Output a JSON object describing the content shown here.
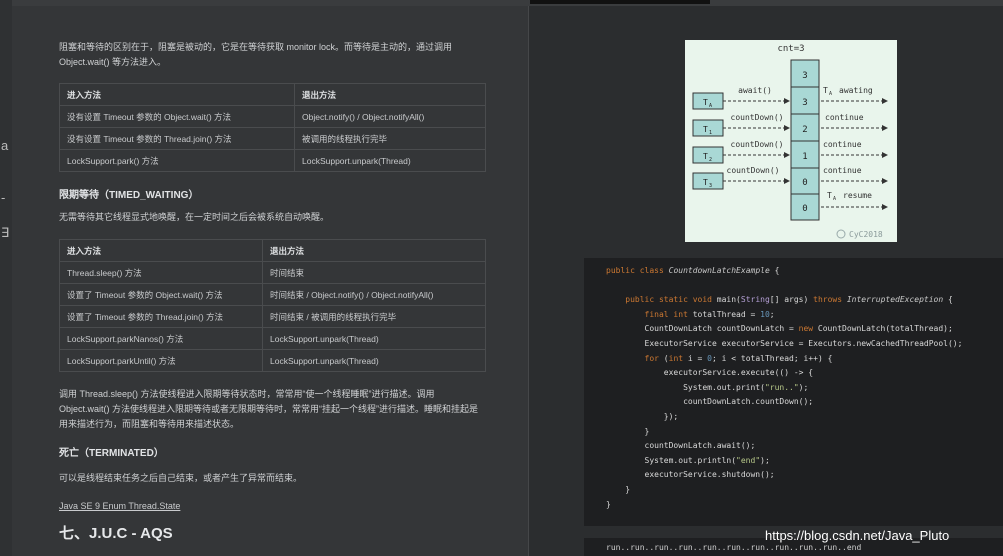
{
  "doc": {
    "intro": "阻塞和等待的区别在于，阻塞是被动的，它是在等待获取 monitor lock。而等待是主动的，通过调用 Object.wait() 等方法进入。",
    "table1": {
      "headers": [
        "进入方法",
        "退出方法"
      ],
      "rows": [
        [
          "没有设置 Timeout 参数的 Object.wait() 方法",
          "Object.notify() / Object.notifyAll()"
        ],
        [
          "没有设置 Timeout 参数的 Thread.join() 方法",
          "被调用的线程执行完毕"
        ],
        [
          "LockSupport.park() 方法",
          "LockSupport.unpark(Thread)"
        ]
      ]
    },
    "timed_heading": "限期等待（TIMED_WAITING）",
    "timed_desc": "无需等待其它线程显式地唤醒，在一定时间之后会被系统自动唤醒。",
    "table2": {
      "headers": [
        "进入方法",
        "退出方法"
      ],
      "rows": [
        [
          "Thread.sleep() 方法",
          "时间结束"
        ],
        [
          "设置了 Timeout 参数的 Object.wait() 方法",
          "时间结束 / Object.notify() / Object.notifyAll()"
        ],
        [
          "设置了 Timeout 参数的 Thread.join() 方法",
          "时间结束 / 被调用的线程执行完毕"
        ],
        [
          "LockSupport.parkNanos() 方法",
          "LockSupport.unpark(Thread)"
        ],
        [
          "LockSupport.parkUntil() 方法",
          "LockSupport.unpark(Thread)"
        ]
      ]
    },
    "sleep_para": "调用 Thread.sleep() 方法使线程进入限期等待状态时，常常用“使一个线程睡眠”进行描述。调用 Object.wait() 方法使线程进入限期等待或者无限期等待时，常常用“挂起一个线程”进行描述。睡眠和挂起是用来描述行为，而阻塞和等待用来描述状态。",
    "terminated_heading": "死亡（TERMINATED）",
    "terminated_desc": "可以是线程结束任务之后自己结束，或者产生了异常而结束。",
    "link": "Java SE 9 Enum Thread.State",
    "section_heading": "七、J.U.C - AQS"
  },
  "diagram": {
    "title": "cnt=3",
    "threads": [
      "T",
      "T",
      "T",
      "T"
    ],
    "thread_subs": [
      "A",
      "1",
      "2",
      "3"
    ],
    "calls": [
      "await()",
      "countDown()",
      "countDown()",
      "countDown()"
    ],
    "counts": [
      "3",
      "3",
      "2",
      "1",
      "0",
      "0"
    ],
    "results": [
      "T",
      "continue",
      "continue",
      "continue",
      "T"
    ],
    "result_awaiting": "awating",
    "result_resume": "resume",
    "result_sub": "A",
    "watermark": "CyC2018"
  },
  "code": {
    "lines": [
      "public class CountdownLatchExample {",
      "",
      "    public static void main(String[] args) throws InterruptedException {",
      "        final int totalThread = 10;",
      "        CountDownLatch countDownLatch = new CountDownLatch(totalThread);",
      "        ExecutorService executorService = Executors.newCachedThreadPool();",
      "        for (int i = 0; i < totalThread; i++) {",
      "            executorService.execute(() -> {",
      "                System.out.print(\"run..\");",
      "                countDownLatch.countDown();",
      "            });",
      "        }",
      "        countDownLatch.await();",
      "        System.out.println(\"end\");",
      "        executorService.shutdown();",
      "    }",
      "}"
    ],
    "output": "run..run..run..run..run..run..run..run..run..run..end"
  },
  "watermark": "https://blog.csdn.net/Java_Pluto",
  "colors": {
    "page_bg": "#343638",
    "code_bg": "#1e1f21",
    "diagram_bg": "#e9f5ec",
    "teal_box": "#a9d8d5",
    "keyword": "#cc7832"
  }
}
